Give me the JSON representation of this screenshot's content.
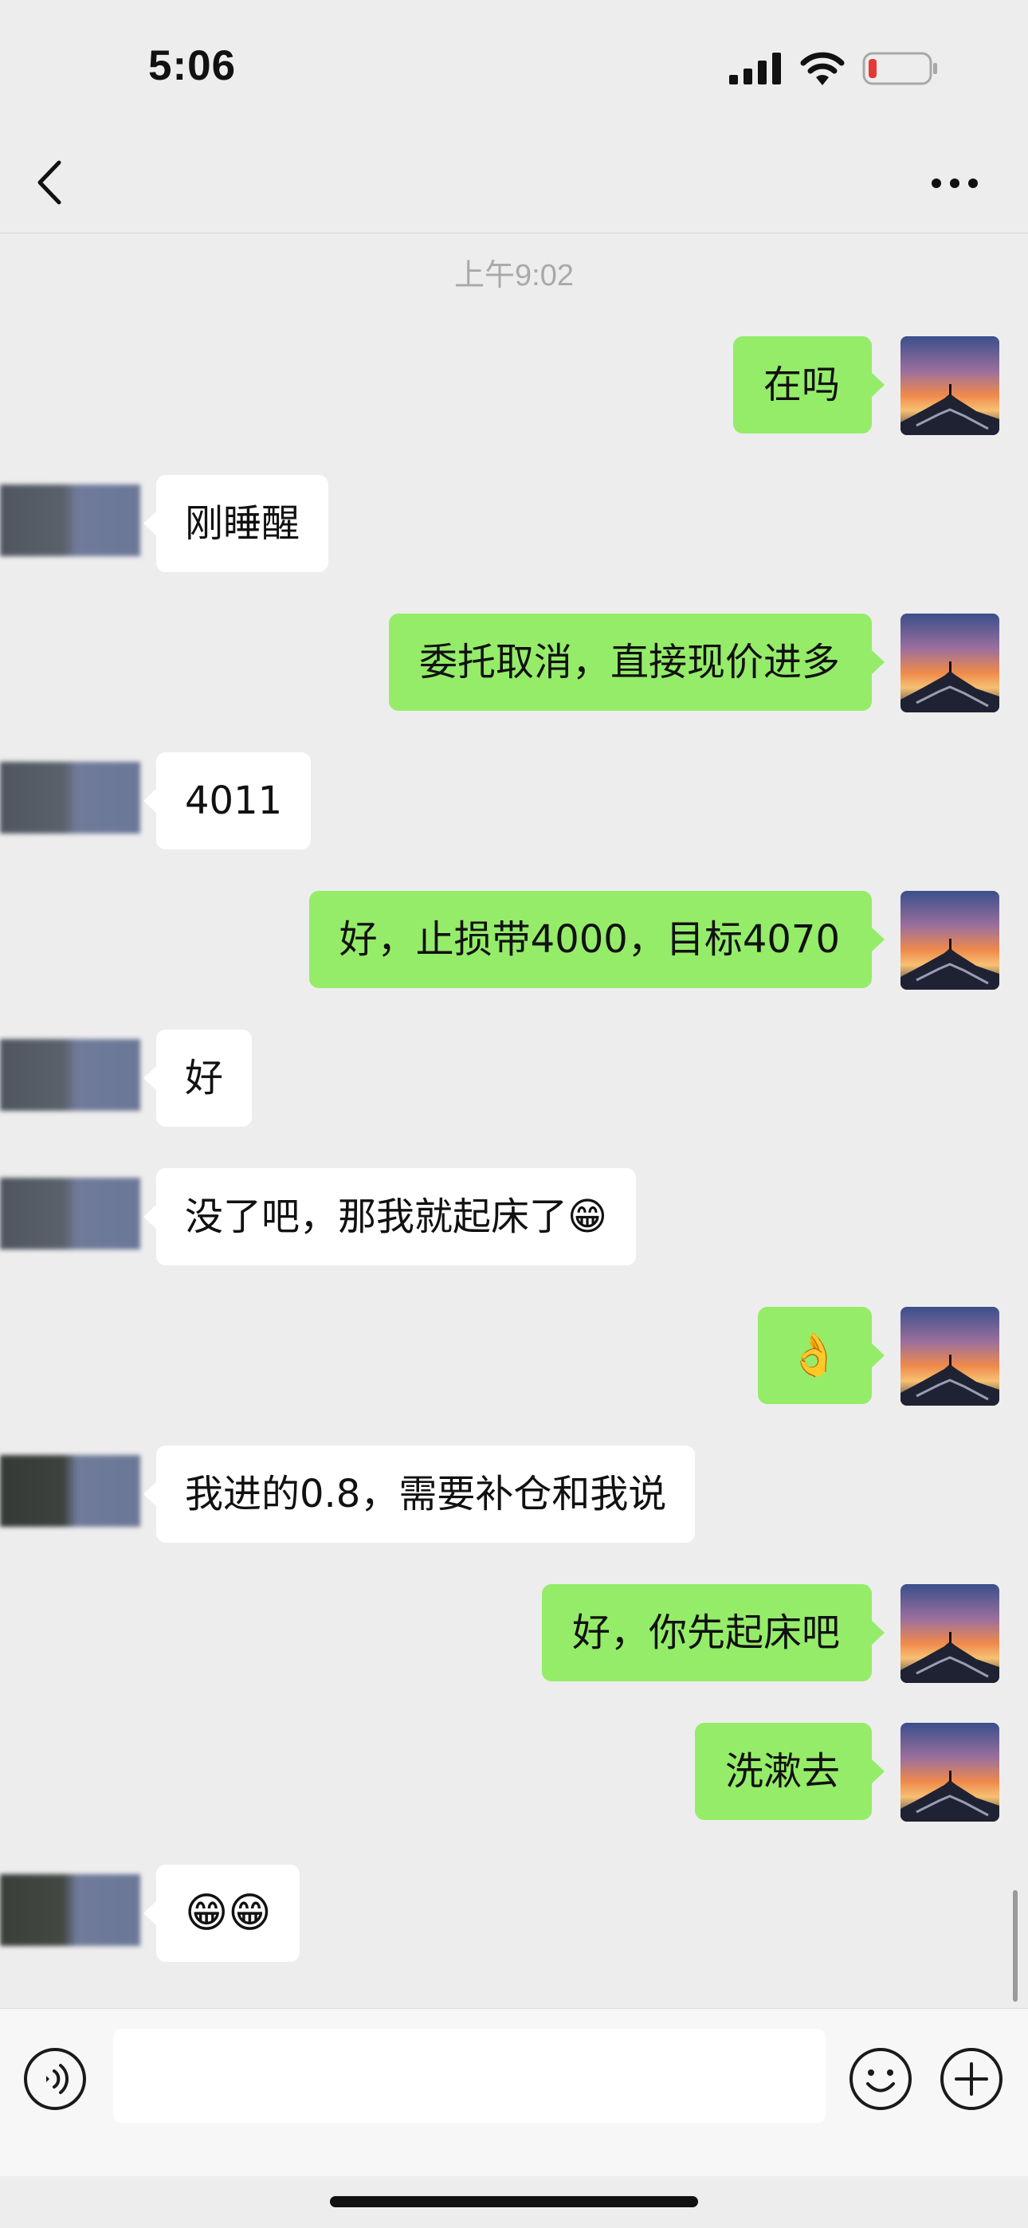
{
  "status_bar": {
    "time": "5:06"
  },
  "chat": {
    "timestamp": "上午9:02",
    "messages": [
      {
        "side": "sent",
        "text": "在吗"
      },
      {
        "side": "recv",
        "text": "刚睡醒"
      },
      {
        "side": "sent",
        "text": "委托取消，直接现价进多"
      },
      {
        "side": "recv",
        "text": "4011"
      },
      {
        "side": "sent",
        "text": "好，止损带4000，目标4070"
      },
      {
        "side": "recv",
        "text": "好"
      },
      {
        "side": "recv",
        "text": "没了吧，那我就起床了😁"
      },
      {
        "side": "sent",
        "text": "👌"
      },
      {
        "side": "recv",
        "text": "我进的0.8，需要补仓和我说"
      },
      {
        "side": "sent",
        "text": "好，你先起床吧"
      },
      {
        "side": "sent",
        "text": "洗漱去"
      },
      {
        "side": "recv",
        "text": "😁😁"
      }
    ]
  },
  "icons": {
    "back": "back-chevron-icon",
    "more": "more-dots-icon",
    "voice": "voice-icon",
    "emoji": "smiley-icon",
    "add": "plus-icon"
  },
  "colors": {
    "sent_bubble": "#95EC69",
    "recv_bubble": "#FFFFFF",
    "background": "#EDEDED"
  }
}
